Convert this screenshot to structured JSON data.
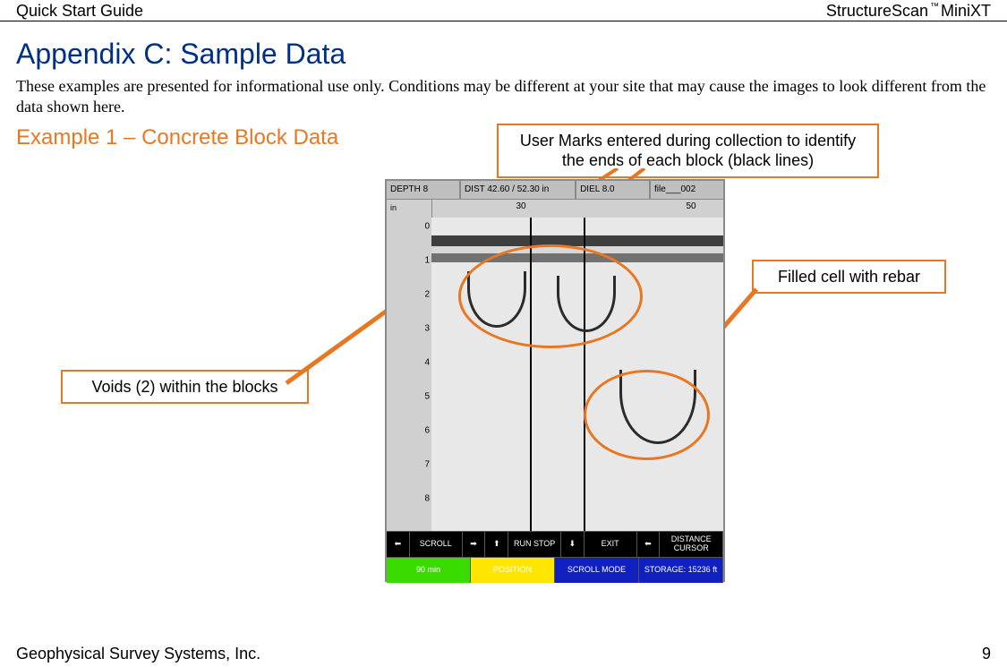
{
  "header": {
    "left": "Quick Start Guide",
    "right_product": "StructureScan",
    "right_tm": "™",
    "right_model": " MiniXT"
  },
  "appendix_title": "Appendix C: Sample Data",
  "intro_text": "These examples are presented for informational use only. Conditions may be different at your site that may cause the images to look different from the data shown here.",
  "example_title": "Example 1 – Concrete Block Data",
  "callouts": {
    "user_marks": "User Marks entered during collection to identify the ends of each block (black lines)",
    "filled_cell": "Filled cell with rebar",
    "voids": "Voids (2) within the blocks"
  },
  "device": {
    "status": {
      "depth": "DEPTH  8",
      "dist": "DIST 42.60 / 52.30 in",
      "diel": "DIEL 8.0",
      "file": "file___002"
    },
    "axes": {
      "v_unit": "in",
      "v_ticks": [
        "0",
        "1",
        "2",
        "3",
        "4",
        "5",
        "6",
        "7",
        "8"
      ],
      "h_unit": "in",
      "h_ticks": [
        "30",
        "50"
      ]
    },
    "controls_row_black": {
      "scroll_left": "⬅",
      "scroll_label": "SCROLL",
      "scroll_right": "➡",
      "up": "⬆",
      "run_stop": "RUN STOP",
      "down": "⬇",
      "exit": "EXIT",
      "dist_left": "⬅",
      "distance_cursor": "DISTANCE CURSOR"
    },
    "controls_row_bot": {
      "battery": "90 min",
      "position": "POSITION",
      "scroll_mode": "SCROLL MODE",
      "storage": "STORAGE: 15236 ft"
    }
  },
  "footer": {
    "company": "Geophysical Survey Systems, Inc.",
    "page": "9"
  }
}
